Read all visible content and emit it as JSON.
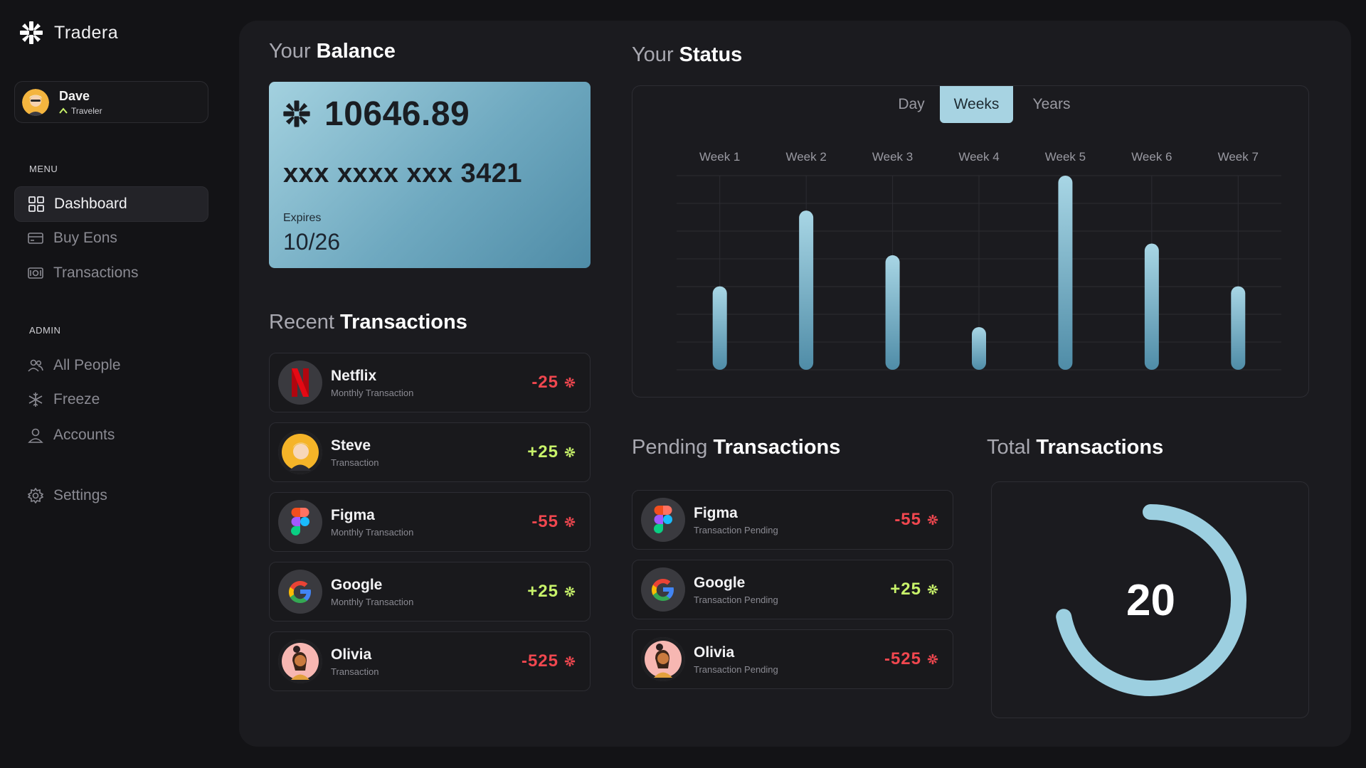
{
  "brand": {
    "name": "Tradera"
  },
  "user": {
    "name": "Dave",
    "role": "Traveler"
  },
  "menu": {
    "label": "MENU",
    "items": [
      {
        "label": "Dashboard",
        "icon": "dashboard-icon",
        "active": true
      },
      {
        "label": "Buy Eons",
        "icon": "card-icon"
      },
      {
        "label": "Transactions",
        "icon": "cash-icon"
      }
    ]
  },
  "admin": {
    "label": "ADMIN",
    "items": [
      {
        "label": "All People",
        "icon": "people-icon"
      },
      {
        "label": "Freeze",
        "icon": "snowflake-icon"
      },
      {
        "label": "Accounts",
        "icon": "user-icon"
      }
    ]
  },
  "settings": {
    "label": "Settings",
    "icon": "gear-icon"
  },
  "balance": {
    "title_light": "Your",
    "title_bold": "Balance",
    "amount": "10646.89",
    "card_number": "xxx xxxx xxx 3421",
    "expires_label": "Expires",
    "expires": "10/26"
  },
  "recent": {
    "title_light": "Recent",
    "title_bold": "Transactions",
    "items": [
      {
        "name": "Netflix",
        "sub": "Monthly Transaction",
        "amount": "-25",
        "sign": "neg",
        "logo": "netflix-logo"
      },
      {
        "name": "Steve",
        "sub": "Transaction",
        "amount": "+25",
        "sign": "pos",
        "logo": "steve-avatar"
      },
      {
        "name": "Figma",
        "sub": "Monthly Transaction",
        "amount": "-55",
        "sign": "neg",
        "logo": "figma-logo"
      },
      {
        "name": "Google",
        "sub": "Monthly Transaction",
        "amount": "+25",
        "sign": "pos",
        "logo": "google-logo"
      },
      {
        "name": "Olivia",
        "sub": "Transaction",
        "amount": "-525",
        "sign": "neg",
        "logo": "olivia-avatar"
      }
    ]
  },
  "status": {
    "title_light": "Your",
    "title_bold": "Status",
    "tabs": [
      {
        "label": "Day"
      },
      {
        "label": "Weeks",
        "active": true
      },
      {
        "label": "Years"
      }
    ]
  },
  "chart_data": {
    "type": "bar",
    "categories": [
      "Week 1",
      "Week 2",
      "Week 3",
      "Week 4",
      "Week 5",
      "Week 6",
      "Week 7"
    ],
    "values": [
      43,
      82,
      59,
      22,
      100,
      65,
      43
    ],
    "ylim": [
      0,
      100
    ],
    "grid": true,
    "bar_color": "#8fc4d6"
  },
  "pending": {
    "title_light": "Pending",
    "title_bold": "Transactions",
    "items": [
      {
        "name": "Figma",
        "sub": "Transaction Pending",
        "amount": "-55",
        "sign": "neg",
        "logo": "figma-logo"
      },
      {
        "name": "Google",
        "sub": "Transaction Pending",
        "amount": "+25",
        "sign": "pos",
        "logo": "google-logo"
      },
      {
        "name": "Olivia",
        "sub": "Transaction Pending",
        "amount": "-525",
        "sign": "neg",
        "logo": "olivia-avatar"
      }
    ]
  },
  "total": {
    "title_light": "Total",
    "title_bold": "Transactions",
    "value": "20",
    "ring_fraction": 0.72,
    "ring_color": "#9ccfe0"
  },
  "colors": {
    "negative": "#f0474f",
    "positive": "#c8f26a",
    "accent": "#a7d3e2"
  }
}
